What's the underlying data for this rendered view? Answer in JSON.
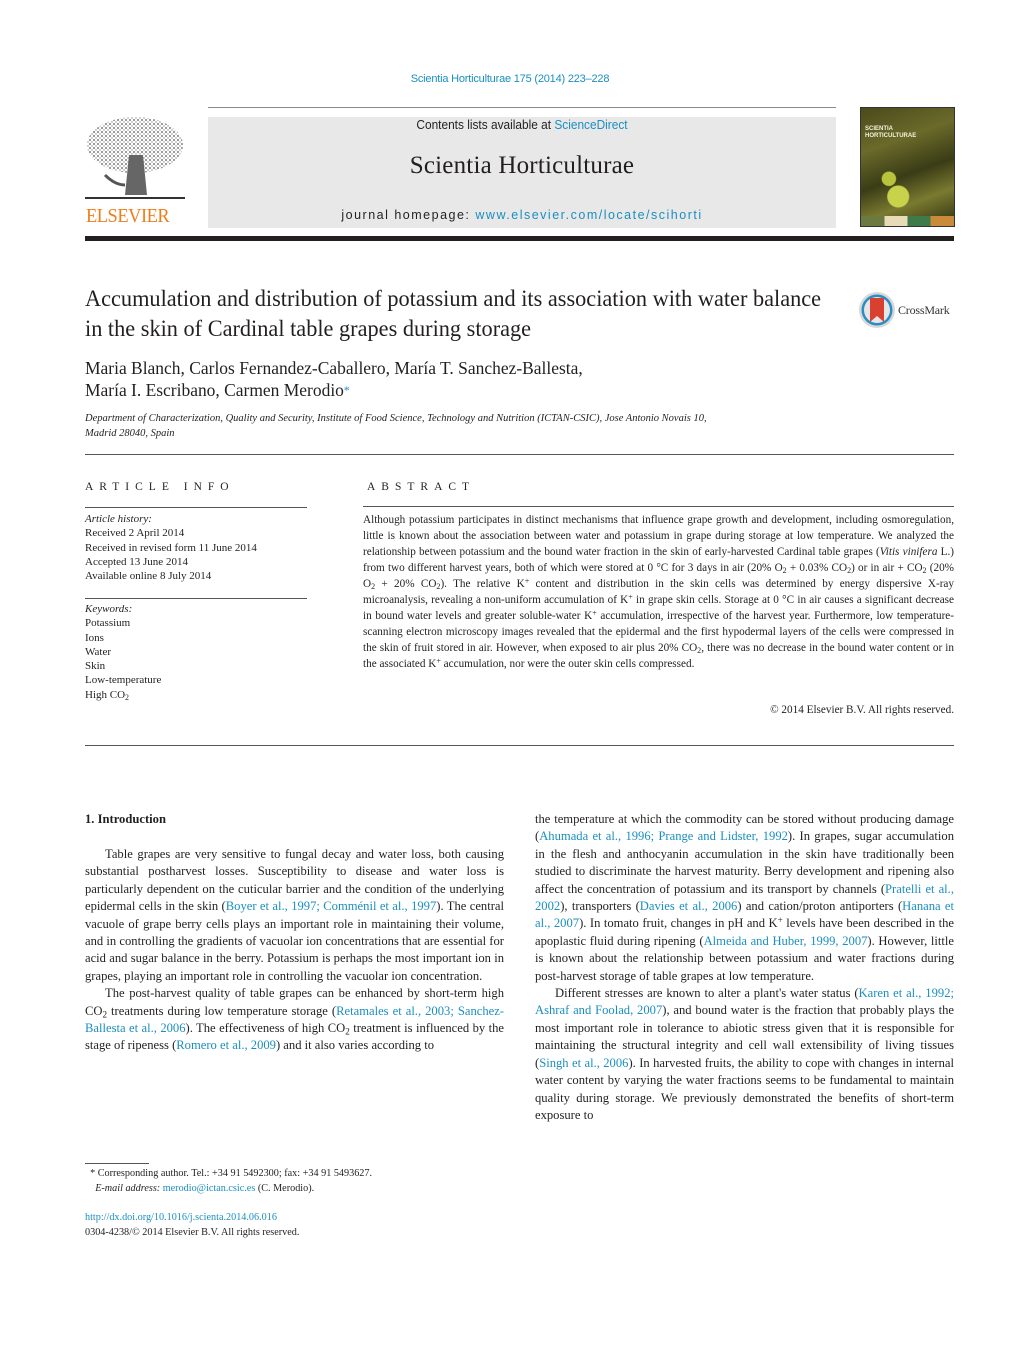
{
  "header": {
    "citation": "Scientia Horticulturae 175 (2014) 223–228",
    "contents_prefix": "Contents lists available at ",
    "contents_link": "ScienceDirect",
    "journal_name": "Scientia Horticulturae",
    "homepage_prefix": "journal homepage: ",
    "homepage_link": "www.elsevier.com/locate/scihorti",
    "publisher_logo_text": "ELSEVIER",
    "cover_title_line1": "SCIENTIA",
    "cover_title_line2": "HORTICULTURAE",
    "crossmark_label": "CrossMark"
  },
  "article": {
    "title": "Accumulation and distribution of potassium and its association with water balance in the skin of Cardinal table grapes during storage",
    "authors_line1": "Maria Blanch, Carlos Fernandez-Caballero, María T. Sanchez-Ballesta,",
    "authors_line2": "María I. Escribano, Carmen Merodio",
    "corresponding_marker": "*",
    "affiliation_line1": "Department of Characterization, Quality and Security, Institute of Food Science, Technology and Nutrition (ICTAN-CSIC), Jose Antonio Novais 10,",
    "affiliation_line2": "Madrid 28040, Spain"
  },
  "article_info": {
    "heading": "ARTICLE INFO",
    "history_label": "Article history:",
    "history": [
      "Received 2 April 2014",
      "Received in revised form 11 June 2014",
      "Accepted 13 June 2014",
      "Available online 8 July 2014"
    ],
    "keywords_label": "Keywords:",
    "keywords": [
      "Potassium",
      "Ions",
      "Water",
      "Skin",
      "Low-temperature",
      "High CO"
    ],
    "keyword_subscript": "2"
  },
  "abstract": {
    "heading": "ABSTRACT",
    "p1": "Although potassium participates in distinct mechanisms that influence grape growth and development, including osmoregulation, little is known about the association between water and potassium in grape during storage at low temperature. We analyzed the relationship between potassium and the bound water fraction in the skin of early-harvested Cardinal table grapes (",
    "species": "Vitis vinifera",
    "p2": " L.) from two different harvest years, both of which were stored at 0 °C for 3 days in air (20% O",
    "p3": " + 0.03% CO",
    "p4": ") or in air + CO",
    "p5": " (20% O",
    "p6": " + 20% CO",
    "p7": "). The relative K",
    "p8": " content and distribution in the skin cells was determined by energy dispersive X-ray microanalysis, revealing a non-uniform accumulation of K",
    "p9": " in grape skin cells. Storage at 0 °C in air causes a significant decrease in bound water levels and greater soluble-water K",
    "p10": " accumulation, irrespective of the harvest year. Furthermore, low temperature-scanning electron microscopy images revealed that the epidermal and the first hypodermal layers of the cells were compressed in the skin of fruit stored in air. However, when exposed to air plus 20% CO",
    "p11": ", there was no decrease in the bound water content or in the associated K",
    "p12": " accumulation, nor were the outer skin cells compressed.",
    "sub2": "2",
    "plus": "+",
    "copyright": "© 2014 Elsevier B.V. All rights reserved."
  },
  "intro": {
    "heading": "1.  Introduction",
    "para1_a": "Table grapes are very sensitive to fungal decay and water loss, both causing substantial postharvest losses. Susceptibility to disease and water loss is particularly dependent on the cuticular barrier and the condition of the underlying epidermal cells in the skin (",
    "ref_boyer": "Boyer et al., 1997; Comménil et al., 1997",
    "para1_b": "). The central vacuole of grape berry cells plays an important role in maintaining their volume, and in controlling the gradients of vacuolar ion concentrations that are essential for acid and sugar balance in the berry. Potassium is perhaps the most important ion in grapes, playing an important role in controlling the vacuolar ion concentration.",
    "para2_a": "The post-harvest quality of table grapes can be enhanced by short-term high CO",
    "para2_b": " treatments during low temperature storage (",
    "ref_retamales": "Retamales et al., 2003; Sanchez-Ballesta et al., 2006",
    "para2_c": "). The effectiveness of high CO",
    "para2_d": " treatment is influenced by the stage of ripeness (",
    "ref_romero": "Romero et al., 2009",
    "para2_e": ") and it also varies according to",
    "right1_a": "the temperature at which the commodity can be stored without producing damage (",
    "ref_ahumada": "Ahumada et al., 1996; Prange and Lidster, 1992",
    "right1_b": "). In grapes, sugar accumulation in the flesh and anthocyanin accumulation in the skin have traditionally been studied to discriminate the harvest maturity. Berry development and ripening also affect the concentration of potassium and its transport by channels (",
    "ref_pratelli": "Pratelli et al., 2002",
    "right1_c": "), transporters (",
    "ref_davies": "Davies et al., 2006",
    "right1_d": ") and cation/proton antiporters (",
    "ref_hanana": "Hanana et al., 2007",
    "right1_e": "). In tomato fruit, changes in pH and K",
    "right1_f": " levels have been described in the apoplastic fluid during ripening (",
    "ref_almeida": "Almeida and Huber, 1999, 2007",
    "right1_g": "). However, little is known about the relationship between potassium and water fractions during post-harvest storage of table grapes at low temperature.",
    "right2_a": "Different stresses are known to alter a plant's water status (",
    "ref_karen": "Karen et al., 1992; Ashraf and Foolad, 2007",
    "right2_b": "), and bound water is the fraction that probably plays the most important role in tolerance to abiotic stress given that it is responsible for maintaining the structural integrity and cell wall extensibility of living tissues (",
    "ref_singh": "Singh et al., 2006",
    "right2_c": "). In harvested fruits, the ability to cope with changes in internal water content by varying the water fractions seems to be fundamental to maintain quality during storage. We previously demonstrated the benefits of short-term exposure to"
  },
  "footnote": {
    "marker": "*",
    "text": " Corresponding author. Tel.: +34 91 5492300; fax: +34 91 5493627.",
    "email_label": "E-mail address: ",
    "email": "merodio@ictan.csic.es",
    "email_suffix": " (C. Merodio).",
    "doi": "http://dx.doi.org/10.1016/j.scienta.2014.06.016",
    "issn": "0304-4238/© 2014 Elsevier B.V. All rights reserved."
  }
}
